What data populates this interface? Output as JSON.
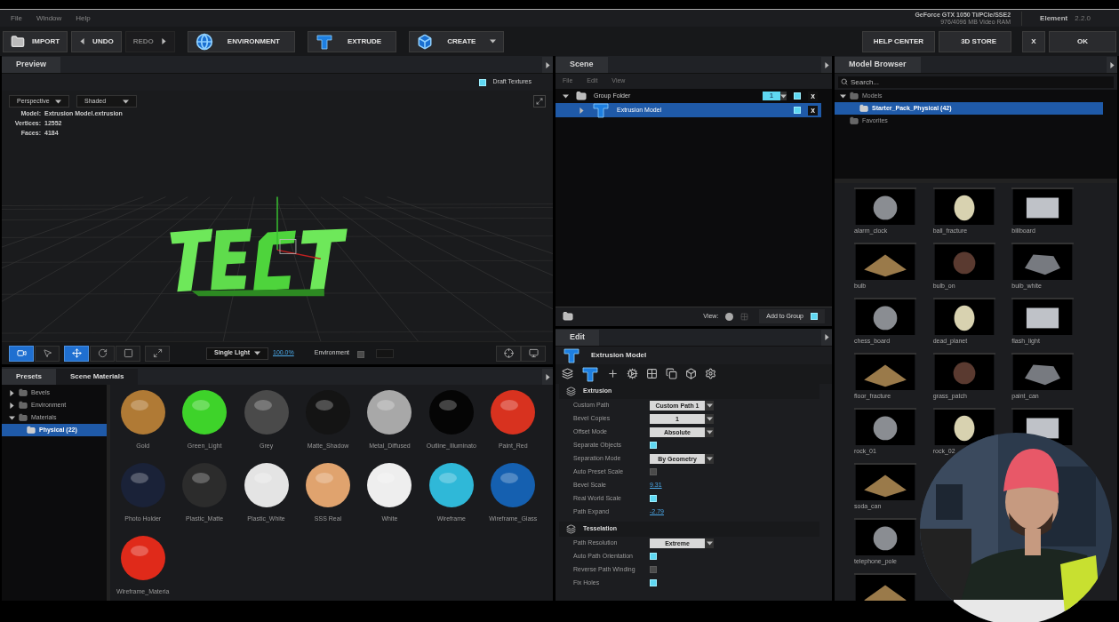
{
  "menu": [
    "File",
    "Window",
    "Help"
  ],
  "gpu": {
    "name": "GeForce GTX 1050 Ti/PCIe/SSE2",
    "memory": "976/4096 MB Video RAM"
  },
  "app": {
    "name": "Element",
    "version": "2.2.0"
  },
  "toolbar_left": [
    {
      "label": "IMPORT",
      "disabled": false
    },
    {
      "label": "UNDO",
      "disabled": false
    },
    {
      "label": "REDO",
      "disabled": true
    },
    {
      "label": "ENVIRONMENT",
      "disabled": false
    },
    {
      "label": "EXTRUDE",
      "disabled": false
    },
    {
      "label": "CREATE",
      "disabled": false
    }
  ],
  "toolbar_right": [
    {
      "label": "HELP CENTER"
    },
    {
      "label": "3D STORE"
    },
    {
      "label": "X"
    },
    {
      "label": "OK"
    }
  ],
  "preview": {
    "tab": "Preview",
    "draft_textures": {
      "label": "Draft Textures",
      "checked": true
    },
    "view_mode": "Perspective",
    "shading": "Shaded",
    "stats": [
      {
        "label": "Model:",
        "value": "Extrusion Model.extrusion"
      },
      {
        "label": "Vertices:",
        "value": "12552"
      },
      {
        "label": "Faces:",
        "value": "4184"
      }
    ]
  },
  "viewport_toolbar": {
    "tools": [
      {
        "selected": true
      },
      {
        "selected": false
      },
      {
        "selected": true
      },
      {
        "selected": false
      },
      {
        "selected": false
      },
      {
        "selected": false
      }
    ],
    "light": "Single Light",
    "zoom": "100.0%",
    "environment": {
      "label": "Environment",
      "checked": false
    }
  },
  "presets": {
    "tabs": [
      {
        "label": "Presets",
        "selected": true
      },
      {
        "label": "Scene Materials",
        "selected": false
      }
    ],
    "tree": [
      {
        "label": "Bevels",
        "expanded": false,
        "selected": false
      },
      {
        "label": "Environment",
        "expanded": false,
        "selected": false
      },
      {
        "label": "Materials",
        "expanded": true,
        "selected": false,
        "children": [
          {
            "label": "Physical (22)",
            "selected": true
          }
        ]
      }
    ],
    "materials": [
      {
        "name": "Gold",
        "color": "#b07a35"
      },
      {
        "name": "Green_Light",
        "color": "#3ed32a"
      },
      {
        "name": "Grey",
        "color": "#4a4a4a"
      },
      {
        "name": "Matte_Shadow",
        "color": "#141414"
      },
      {
        "name": "Metal_Diffused",
        "color": "#a8a8a8"
      },
      {
        "name": "Outline_Illuminato",
        "color": "#050505"
      },
      {
        "name": "Paint_Red",
        "color": "#d8321f"
      },
      {
        "name": "Photo Holder",
        "color": "#1a2238"
      },
      {
        "name": "Plastic_Matte",
        "color": "#2c2c2c"
      },
      {
        "name": "Plastic_White",
        "color": "#e4e4e4"
      },
      {
        "name": "SSS Real",
        "color": "#e0a36e"
      },
      {
        "name": "White",
        "color": "#eeeeee"
      },
      {
        "name": "Wireframe",
        "color": "#2fb8d8"
      },
      {
        "name": "Wireframe_Glass",
        "color": "#1560b0"
      },
      {
        "name": "Wireframe_Materia",
        "color": "#e02a1a"
      }
    ]
  },
  "scene": {
    "tab": "Scene",
    "menu": [
      "File",
      "Edit",
      "View"
    ],
    "tree": [
      {
        "label": "Group Folder",
        "expanded": true,
        "selected": false,
        "count": "1",
        "visible": true,
        "remove": "X",
        "children": [
          {
            "label": "Extrusion Model",
            "expanded": false,
            "selected": true,
            "visible": true,
            "remove": "X"
          }
        ]
      }
    ],
    "view_label": "View:",
    "add_to_group": {
      "label": "Add to Group",
      "checked": true
    }
  },
  "edit": {
    "tab": "Edit",
    "title": "Extrusion Model",
    "sections": [
      {
        "title": "Extrusion",
        "props": [
          {
            "label": "Custom Path",
            "kind": "dropdown",
            "value": "Custom Path 1"
          },
          {
            "label": "Bevel Copies",
            "kind": "dropdown",
            "value": "1"
          },
          {
            "label": "Offset Mode",
            "kind": "dropdown",
            "value": "Absolute"
          },
          {
            "label": "Separate Objects",
            "kind": "checkbox",
            "checked": true
          },
          {
            "label": "Separation Mode",
            "kind": "dropdown",
            "value": "By Geometry"
          },
          {
            "label": "Auto Preset Scale",
            "kind": "checkbox",
            "checked": false
          },
          {
            "label": "Bevel Scale",
            "kind": "number",
            "value": "9.31"
          },
          {
            "label": "Real World Scale",
            "kind": "checkbox",
            "checked": true
          },
          {
            "label": "Path Expand",
            "kind": "number",
            "value": "-2.79"
          }
        ]
      },
      {
        "title": "Tesselation",
        "props": [
          {
            "label": "Path Resolution",
            "kind": "dropdown",
            "value": "Extreme"
          },
          {
            "label": "Auto Path Orientation",
            "kind": "checkbox",
            "checked": true
          },
          {
            "label": "Reverse Path Winding",
            "kind": "checkbox",
            "checked": false
          },
          {
            "label": "Fix Holes",
            "kind": "checkbox",
            "checked": true
          }
        ]
      }
    ]
  },
  "model_browser": {
    "tab": "Model Browser",
    "search_placeholder": "Search...",
    "tree": [
      {
        "label": "Models",
        "selected": false,
        "children": [
          {
            "label": "Starter_Pack_Physical (42)",
            "selected": true
          }
        ]
      },
      {
        "label": "Favorites",
        "selected": false
      }
    ],
    "model_rows": [
      [
        {
          "kind": "model",
          "name": "alarm_clock"
        },
        {
          "kind": "model",
          "name": "ball_fracture"
        },
        {
          "kind": "model",
          "name": "billboard"
        }
      ],
      [
        {
          "kind": "model",
          "name": "bulb"
        },
        {
          "kind": "model",
          "name": "bulb_on"
        },
        {
          "kind": "model",
          "name": "bulb_white"
        }
      ],
      [
        {
          "kind": "model",
          "name": "chess_board"
        },
        {
          "kind": "model",
          "name": "dead_planet"
        },
        {
          "kind": "model",
          "name": "flash_light"
        }
      ],
      [
        {
          "kind": "model",
          "name": "floor_fracture"
        },
        {
          "kind": "model",
          "name": "grass_patch"
        },
        {
          "kind": "model",
          "name": "paint_can"
        }
      ],
      [
        {
          "kind": "model",
          "name": "rock_01"
        },
        {
          "kind": "model",
          "name": "rock_02"
        },
        {
          "kind": "picture"
        }
      ],
      [
        {
          "kind": "model",
          "name": "soda_can"
        }
      ],
      [
        {
          "kind": "model",
          "name": "telephone_pole"
        }
      ],
      [
        {
          "kind": "picture"
        }
      ]
    ]
  }
}
